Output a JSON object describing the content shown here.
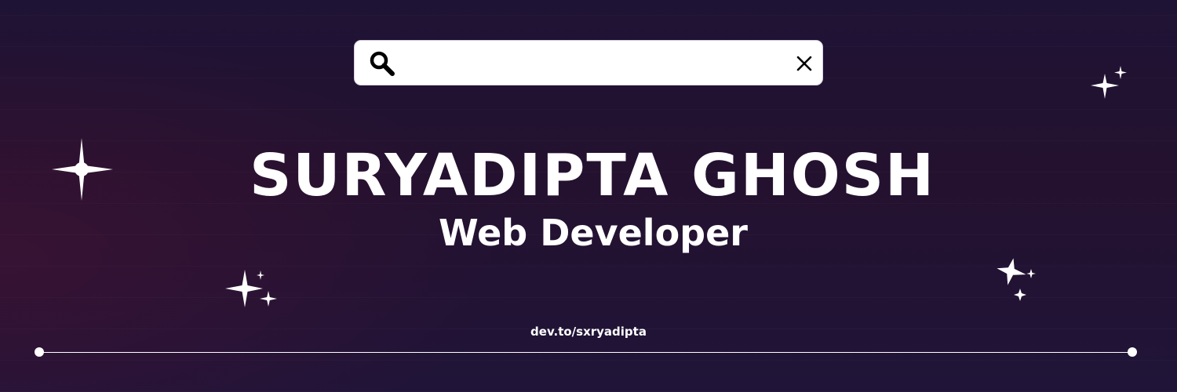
{
  "search": {
    "value": "",
    "placeholder": ""
  },
  "profile": {
    "name": "SURYADIPTA GHOSH",
    "role": "Web Developer",
    "link": "dev.to/sxryadipta"
  },
  "icons": {
    "search": "search-icon",
    "close": "close-icon",
    "decoration": "sparkle-icon"
  },
  "colors": {
    "background": "#22122f",
    "text": "#ffffff",
    "search_bar": "#ffffff"
  }
}
